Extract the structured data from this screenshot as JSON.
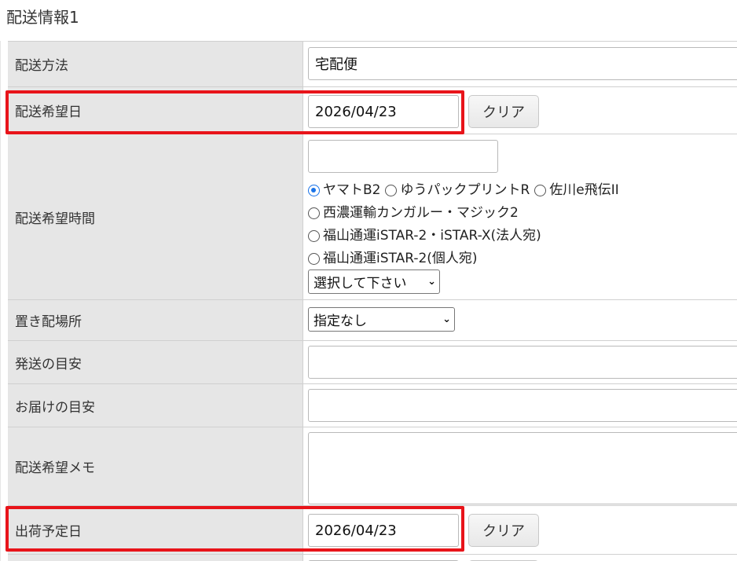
{
  "section_title": "配送情報1",
  "fields": {
    "delivery_method": {
      "label": "配送方法",
      "value": "宅配便"
    },
    "desired_date": {
      "label": "配送希望日",
      "value": "2026/04/23",
      "clear_label": "クリア"
    },
    "desired_time": {
      "label": "配送希望時間",
      "value": "",
      "radio_options": [
        {
          "label": "ヤマトB2",
          "selected": true
        },
        {
          "label": "ゆうパックプリントR",
          "selected": false
        },
        {
          "label": "佐川e飛伝II",
          "selected": false
        },
        {
          "label": "西濃運輸カンガルー・マジック2",
          "selected": false
        },
        {
          "label": "福山通運iSTAR-2・iSTAR-X(法人宛)",
          "selected": false
        },
        {
          "label": "福山通運iSTAR-2(個人宛)",
          "selected": false
        }
      ],
      "select_value": "選択して下さい"
    },
    "drop_location": {
      "label": "置き配場所",
      "select_value": "指定なし"
    },
    "ship_estimate": {
      "label": "発送の目安",
      "value": ""
    },
    "delivery_estimate": {
      "label": "お届けの目安",
      "value": ""
    },
    "delivery_memo": {
      "label": "配送希望メモ",
      "value": ""
    },
    "ship_date": {
      "label": "出荷予定日",
      "value": "2026/04/23",
      "clear_label": "クリア"
    }
  },
  "colors": {
    "highlight": "#e8141a",
    "radio_selected": "#1a73e8",
    "label_bg": "#e6e6e6"
  }
}
